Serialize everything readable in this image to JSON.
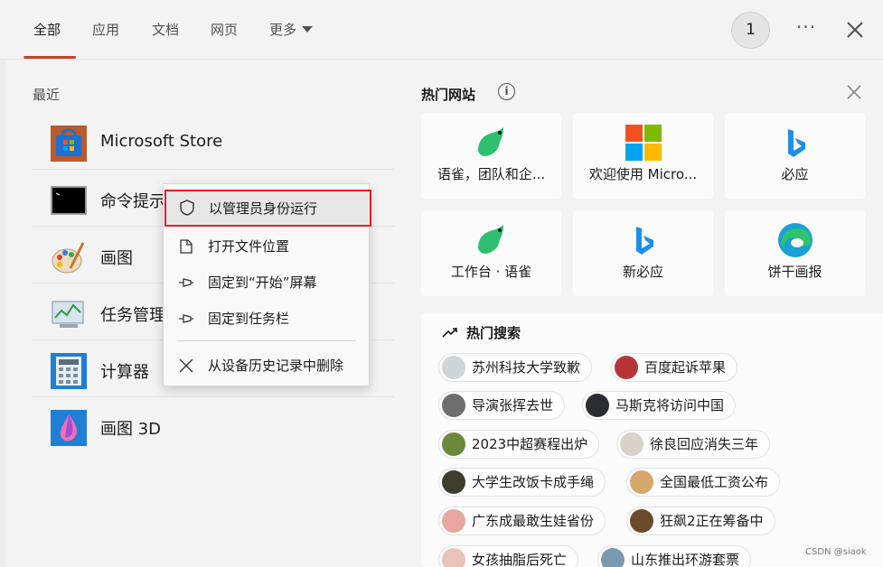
{
  "tabs": [
    {
      "label": "全部"
    },
    {
      "label": "应用"
    },
    {
      "label": "文档"
    },
    {
      "label": "网页"
    },
    {
      "label": "更多"
    }
  ],
  "header": {
    "badge": "1",
    "more_dots": "···"
  },
  "recent": {
    "title": "最近",
    "items": [
      {
        "label": "Microsoft Store",
        "icon": "microsoft-store-icon"
      },
      {
        "label": "命令提示",
        "icon": "command-prompt-icon"
      },
      {
        "label": "画图",
        "icon": "paint-icon"
      },
      {
        "label": "任务管理",
        "icon": "task-manager-icon"
      },
      {
        "label": "计算器",
        "icon": "calculator-icon"
      },
      {
        "label": "画图 3D",
        "icon": "paint-3d-icon"
      }
    ]
  },
  "context_menu": {
    "items": [
      {
        "label": "以管理员身份运行",
        "icon": "shield-icon"
      },
      {
        "label": "打开文件位置",
        "icon": "file-location-icon"
      },
      {
        "label": "固定到“开始”屏幕",
        "icon": "pin-icon"
      },
      {
        "label": "固定到任务栏",
        "icon": "pin-icon"
      },
      {
        "label": "从设备历史记录中删除",
        "icon": "close-icon"
      }
    ]
  },
  "hot_sites": {
    "title": "热门网站",
    "info": "i",
    "sites": [
      {
        "label": "语雀，团队和企...",
        "icon": "yuque-icon"
      },
      {
        "label": "欢迎使用 Micro...",
        "icon": "microsoft-logo-icon"
      },
      {
        "label": "必应",
        "icon": "bing-icon"
      },
      {
        "label": "工作台 · 语雀",
        "icon": "yuque-icon"
      },
      {
        "label": "新必应",
        "icon": "bing-icon"
      },
      {
        "label": "饼干画报",
        "icon": "edge-icon"
      }
    ]
  },
  "hot_search": {
    "title": "热门搜索",
    "items": [
      {
        "label": "苏州科技大学致歉"
      },
      {
        "label": "百度起诉苹果"
      },
      {
        "label": "导演张挥去世"
      },
      {
        "label": "马斯克将访问中国"
      },
      {
        "label": "2023中超赛程出炉"
      },
      {
        "label": "徐良回应消失三年"
      },
      {
        "label": "大学生改饭卡成手绳"
      },
      {
        "label": "全国最低工资公布"
      },
      {
        "label": "广东成最敢生娃省份"
      },
      {
        "label": "狂飙2正在筹备中"
      },
      {
        "label": "女孩抽脂后死亡"
      },
      {
        "label": "山东推出环游套票"
      }
    ]
  },
  "watermark": "CSDN @siaok",
  "colors": {
    "accent": "#c0452b",
    "highlight_border": "#e0202a",
    "background": "#f3f3f3"
  }
}
